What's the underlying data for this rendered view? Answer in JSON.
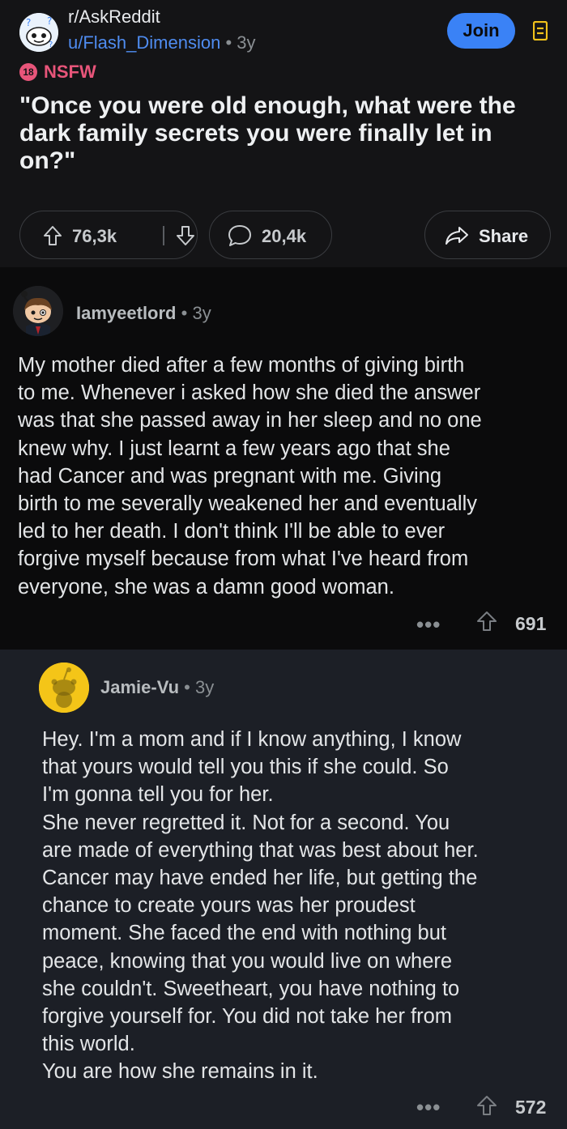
{
  "post": {
    "subreddit": "r/AskReddit",
    "author": "u/Flash_Dimension",
    "separator": "•",
    "age": "3y",
    "join_label": "Join",
    "nsfw_badge": "18",
    "nsfw_label": "NSFW",
    "title": "\"Once you were old enough, what were the dark family secrets you were finally let in on?\"",
    "upvotes": "76,3k",
    "comments": "20,4k",
    "share_label": "Share"
  },
  "comments": [
    {
      "user": "Iamyeetlord",
      "age": "3y",
      "body": "My mother died after a few months of giving birth\nto me. Whenever i asked how she died the answer\nwas that she passed away in her sleep and no one\nknew why. I just learnt a few years ago that she\nhad Cancer and was pregnant with me. Giving\nbirth to me severally weakened her and eventually\nled to her death. I don't think I'll be able to ever\nforgive myself because from what I've heard from\neveryone, she was a damn good woman.",
      "more": "•••",
      "score": "691"
    },
    {
      "user": "Jamie-Vu",
      "age": "3y",
      "body": "Hey. I'm a mom and if I know anything, I know\nthat yours would tell you this if she could. So\nI'm gonna tell you for her.\nShe never regretted it. Not for a second. You\nare made of everything that was best about her.\nCancer may have ended her life, but getting the\nchance to create yours was her proudest\nmoment. She faced the end with nothing but\npeace, knowing that you would live on where\nshe couldn't. Sweetheart, you have nothing to\nforgive yourself for.  You did not take her from\nthis world.\nYou are how she remains in it.",
      "more": "•••",
      "score": "572"
    }
  ],
  "colors": {
    "accent": "#3a82f6",
    "nsfw": "#e8557a",
    "post_bg": "#141416",
    "reply_bg": "#1c1f26"
  }
}
